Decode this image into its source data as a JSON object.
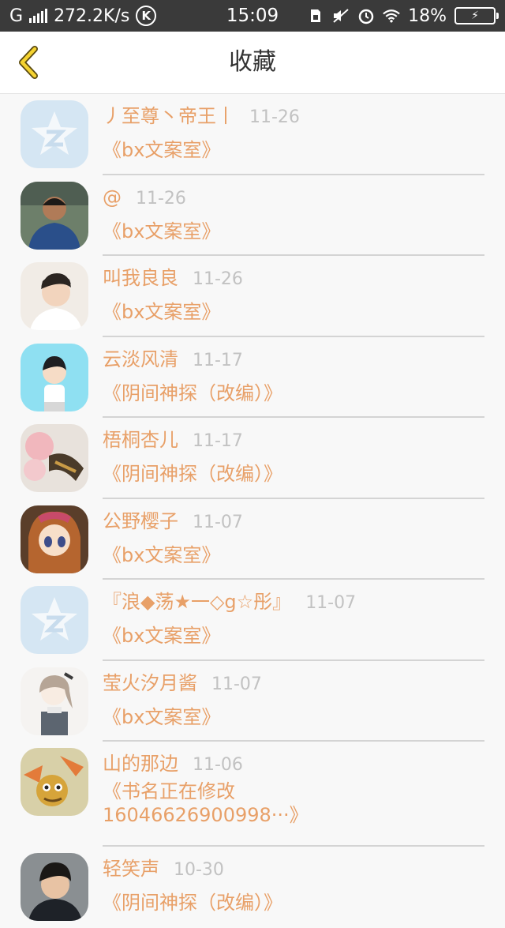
{
  "status_bar": {
    "network": "G",
    "speed": "272.2K/s",
    "k_badge": "K",
    "time": "15:09",
    "battery": "18%",
    "icons": [
      "signal-icon",
      "k-badge-icon",
      "sim-icon",
      "mute-icon",
      "alarm-icon",
      "wifi-icon",
      "battery-icon"
    ]
  },
  "header": {
    "title": "收藏",
    "back_icon": "chevron-left-icon",
    "accent": "#f5d330"
  },
  "colors": {
    "name_text": "#e8a068",
    "date_text": "#c2c2c2",
    "separator": "#d4d4d4"
  },
  "items": [
    {
      "name": "丿至尊丶帝王丨",
      "date": "11-26",
      "book": "《bx文案室》",
      "avatar": "qq-default-avatar"
    },
    {
      "name": "@",
      "date": "11-26",
      "book": "《bx文案室》",
      "avatar": "photo-avatar"
    },
    {
      "name": "叫我良良",
      "date": "11-26",
      "book": "《bx文案室》",
      "avatar": "photo-avatar"
    },
    {
      "name": "云淡风清",
      "date": "11-17",
      "book": "《阴间神探（改编）》",
      "avatar": "cartoon-avatar"
    },
    {
      "name": "梧桐杏儿",
      "date": "11-17",
      "book": "《阴间神探（改编）》",
      "avatar": "photo-avatar"
    },
    {
      "name": "公野樱子",
      "date": "11-07",
      "book": "《bx文案室》",
      "avatar": "anime-avatar"
    },
    {
      "name": "『浪◆荡★一◇g☆彤』",
      "date": "11-07",
      "book": "《bx文案室》",
      "avatar": "qq-default-avatar"
    },
    {
      "name": "莹火汐月酱",
      "date": "11-07",
      "book": "《bx文案室》",
      "avatar": "drawing-avatar"
    },
    {
      "name": "山的那边",
      "date": "11-06",
      "book": "《书名正在修改16046626900998···》",
      "avatar": "cartoon-avatar"
    },
    {
      "name": "轻笑声",
      "date": "10-30",
      "book": "《阴间神探（改编）》",
      "avatar": "photo-avatar"
    }
  ]
}
